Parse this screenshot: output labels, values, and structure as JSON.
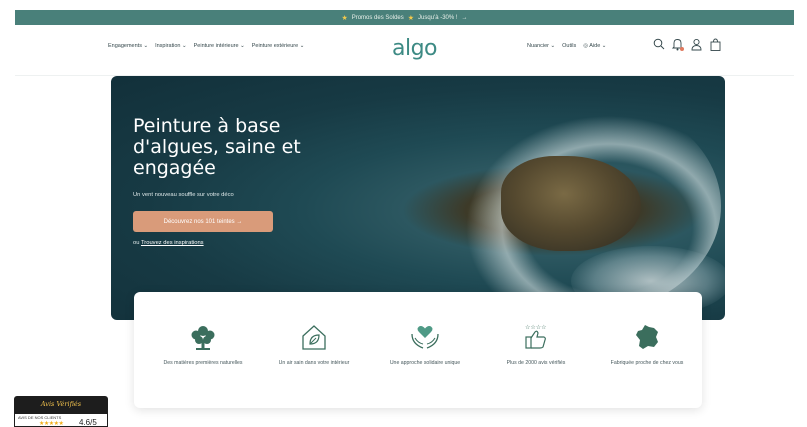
{
  "promo": {
    "text": "Promos des Soldes",
    "text2": "Jusqu'à -30% !",
    "arrow": "→"
  },
  "header": {
    "nav_left": [
      "Engagements",
      "Inspiration",
      "Peinture intérieure",
      "Peinture extérieure"
    ],
    "logo": "algo",
    "nav_right": [
      "Nuancier",
      "Outils",
      "Aide"
    ],
    "icons": [
      "search-icon",
      "bell-icon",
      "user-icon",
      "bag-icon"
    ]
  },
  "hero": {
    "title": "Peinture à base d'algues, saine et engagée",
    "subtitle": "Un vent nouveau souffle sur votre déco",
    "cta": "Découvrez nos 101 teintes →",
    "alt_prefix": "ou",
    "alt_link": "Trouvez des inspirations"
  },
  "features": [
    {
      "icon": "plant-icon",
      "label": "Des matières premières naturelles"
    },
    {
      "icon": "house-leaf-icon",
      "label": "Un air sain dans votre intérieur"
    },
    {
      "icon": "hands-heart-icon",
      "label": "Une approche solidaire unique"
    },
    {
      "icon": "thumbs-up-stars-icon",
      "label": "Plus de 2000 avis vérifiés"
    },
    {
      "icon": "france-map-icon",
      "label": "Fabriquée proche de chez vous"
    }
  ],
  "badge": {
    "title": "Avis Vérifiés",
    "caption": "AVIS DE NOS CLIENTS",
    "stars": "★★★★★",
    "score": "4.6/5"
  },
  "colors": {
    "accent": "#49807a",
    "cta": "#d99b7a",
    "logo": "#3d8a84",
    "icon_green": "#3b6e5d"
  }
}
